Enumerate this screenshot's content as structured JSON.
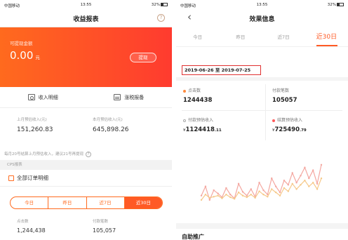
{
  "left": {
    "status": {
      "carrier": "中国移动",
      "time": "13:55",
      "battery": "32%"
    },
    "title": "收益报表",
    "help_icon": "?",
    "banner": {
      "label": "可提现金额",
      "amount": "0.00",
      "unit": "元",
      "withdraw": "提现"
    },
    "links": {
      "income_detail": "收入明细",
      "tax_report": "涨税报备"
    },
    "estimates": {
      "last_month_label": "上月预估收入(元)",
      "last_month_value": "151,260.83",
      "this_month_label": "本月预估收入(元)",
      "this_month_value": "645,898.26"
    },
    "note": "每月20号结算上月预估收入，建议21号再提现",
    "section_cps": "CPS报表",
    "all_orders": "全部订单明细",
    "periods": [
      "今日",
      "昨日",
      "近7日",
      "近30日"
    ],
    "bottom": {
      "clicks_label": "点击数",
      "clicks_value": "1,244,438",
      "paid_label": "付款笔数",
      "paid_value": "105,057"
    }
  },
  "right": {
    "status": {
      "carrier": "中国移动",
      "time": "13:55",
      "battery": "32%"
    },
    "back_icon": "‹",
    "title": "效果信息",
    "tabs": [
      "今日",
      "昨日",
      "近7日",
      "近30日"
    ],
    "date_range": "2019-06-26 至 2019-07-25",
    "metrics": {
      "clicks_label": "点击数",
      "clicks_value": "1244438",
      "paid_label": "付款笔数",
      "paid_value": "105057",
      "paid_est_label": "付款预估收入",
      "paid_est_currency": "¥",
      "paid_est_int": "1124418",
      "paid_est_dec": ".11",
      "settle_est_label": "结算预估收入",
      "settle_est_currency": "¥",
      "settle_est_int": "725490",
      "settle_est_dec": ".79"
    },
    "colors": {
      "accent": "#ff5a25",
      "series_a": "#f4a7a0",
      "series_b": "#f6c98a"
    },
    "section_title": "自助推广"
  },
  "chart_data": {
    "type": "line",
    "title": "",
    "xlabel": "",
    "ylabel": "",
    "x": [
      1,
      2,
      3,
      4,
      5,
      6,
      7,
      8,
      9,
      10,
      11,
      12,
      13,
      14,
      15,
      16,
      17,
      18,
      19,
      20,
      21,
      22,
      23,
      24,
      25,
      26,
      27,
      28,
      29,
      30
    ],
    "series": [
      {
        "values": [
          38,
          55,
          30,
          48,
          42,
          35,
          52,
          40,
          33,
          60,
          45,
          38,
          50,
          36,
          62,
          48,
          40,
          70,
          55,
          44,
          66,
          58,
          80,
          62,
          75,
          90,
          70,
          85,
          60,
          95
        ]
      },
      {
        "values": [
          30,
          40,
          34,
          36,
          38,
          33,
          40,
          35,
          32,
          44,
          38,
          35,
          40,
          34,
          46,
          40,
          36,
          50,
          44,
          38,
          52,
          46,
          60,
          50,
          58,
          66,
          55,
          62,
          50,
          70
        ]
      }
    ],
    "grid": false,
    "legend": "none"
  }
}
